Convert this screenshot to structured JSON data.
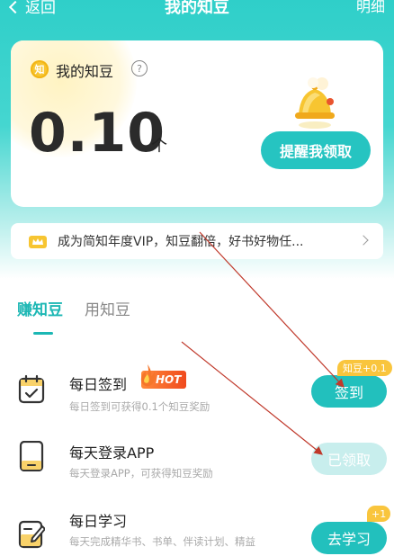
{
  "header": {
    "back_label": "返回",
    "title": "我的知豆",
    "detail_label": "明细"
  },
  "balance_card": {
    "coin_glyph": "知",
    "label": "我的知豆",
    "help_glyph": "?",
    "amount": "0.10",
    "unit": "个",
    "remind_button": "提醒我领取"
  },
  "vip_banner": {
    "text": "成为简知年度VIP，知豆翻倍，好书好物任..."
  },
  "tabs": [
    {
      "label": "赚知豆",
      "active": true
    },
    {
      "label": "用知豆",
      "active": false
    }
  ],
  "tasks": [
    {
      "name": "每日签到",
      "badge": "HOT",
      "desc": "每日签到可获得0.1个知豆奖励",
      "button": "签到",
      "reward": "知豆+0.1",
      "state": "primary"
    },
    {
      "name": "每天登录APP",
      "desc": "每天登录APP，可获得知豆奖励",
      "button": "已领取",
      "state": "done"
    },
    {
      "name": "每日学习",
      "desc": "每天完成精华书、书单、伴读计划、精益",
      "button": "去学习",
      "reward": "+1",
      "state": "primary"
    }
  ],
  "colors": {
    "accent": "#22c0bd",
    "header_gradient_top": "#2fcfc9",
    "coin": "#f7c531",
    "hot": "#f04a1e",
    "annotation_arrow": "#c0392b"
  },
  "icons": {
    "back": "chevron-left-icon",
    "help": "question-circle-icon",
    "bell": "bell-icon",
    "crown": "crown-icon",
    "chevron_right": "chevron-right-icon",
    "calendar": "calendar-check-icon",
    "tablet": "tablet-icon",
    "note": "edit-note-icon"
  }
}
